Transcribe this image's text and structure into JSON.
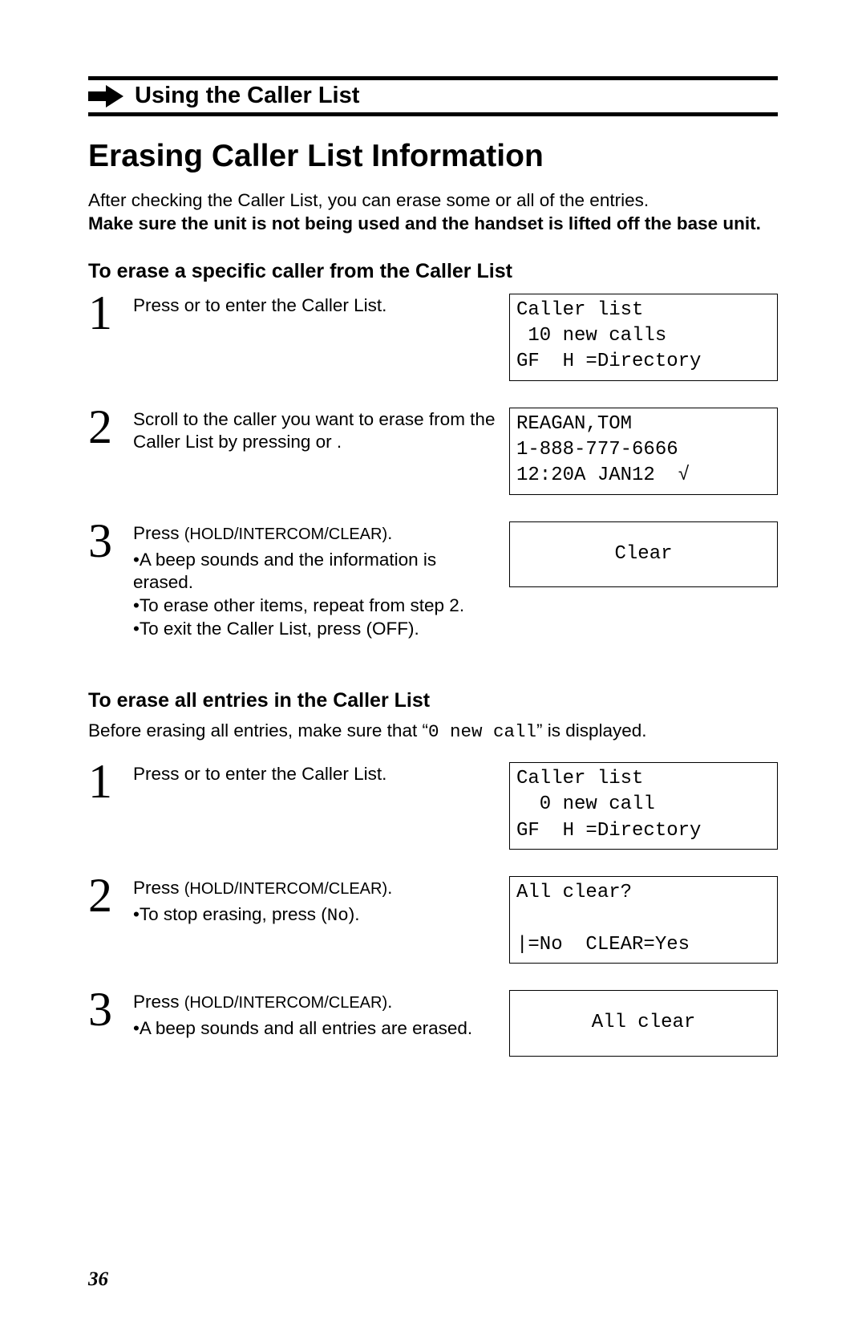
{
  "header": {
    "section_title": "Using the Caller List"
  },
  "title": "Erasing Caller List Information",
  "intro": {
    "line1": "After checking the Caller List, you can erase some or all of the entries.",
    "line2_bold": "Make sure the unit is not being used and the handset is lifted off the base unit."
  },
  "procA": {
    "heading": "To erase a specific caller from the Caller List",
    "steps": [
      {
        "num": "1",
        "text_a": "Press ",
        "text_b": " or ",
        "text_c": " to enter the Caller List.",
        "display": "Caller list\n 10 new calls\nGF  H =Directory"
      },
      {
        "num": "2",
        "text_a": "Scroll to the caller you want to erase from the Caller List by pressing ",
        "text_b": " or ",
        "text_c": ".",
        "display": "REAGAN,TOM\n1-888-777-6666\n12:20A JAN12  √"
      },
      {
        "num": "3",
        "text_a": "Press ",
        "button": "(HOLD/INTERCOM/CLEAR)",
        "text_b": ".",
        "bullets": [
          "•A beep sounds and the information is erased.",
          "•To erase other items, repeat from step 2.",
          "•To exit the Caller List, press (OFF)."
        ],
        "display": "Clear"
      }
    ]
  },
  "procB": {
    "heading": "To erase all entries in the Caller List",
    "before_a": "Before erasing all entries, make sure that “",
    "before_mono": "0 new call",
    "before_b": "” is displayed.",
    "steps": [
      {
        "num": "1",
        "text_a": "Press ",
        "text_b": " or ",
        "text_c": " to enter the Caller List.",
        "display": "Caller list\n  0 new call\nGF  H =Directory"
      },
      {
        "num": "2",
        "text_a": "Press ",
        "button": "(HOLD/INTERCOM/CLEAR)",
        "text_b": ".",
        "bullet_a": "•To stop erasing, press ",
        "bullet_b": " (",
        "bullet_mono": "No",
        "bullet_c": ").",
        "display": "All clear?\n\n|=No  CLEAR=Yes"
      },
      {
        "num": "3",
        "text_a": "Press ",
        "button": "(HOLD/INTERCOM/CLEAR)",
        "text_b": ".",
        "bullet": "•A beep sounds and all entries are erased.",
        "display": "All clear"
      }
    ]
  },
  "page_number": "36"
}
